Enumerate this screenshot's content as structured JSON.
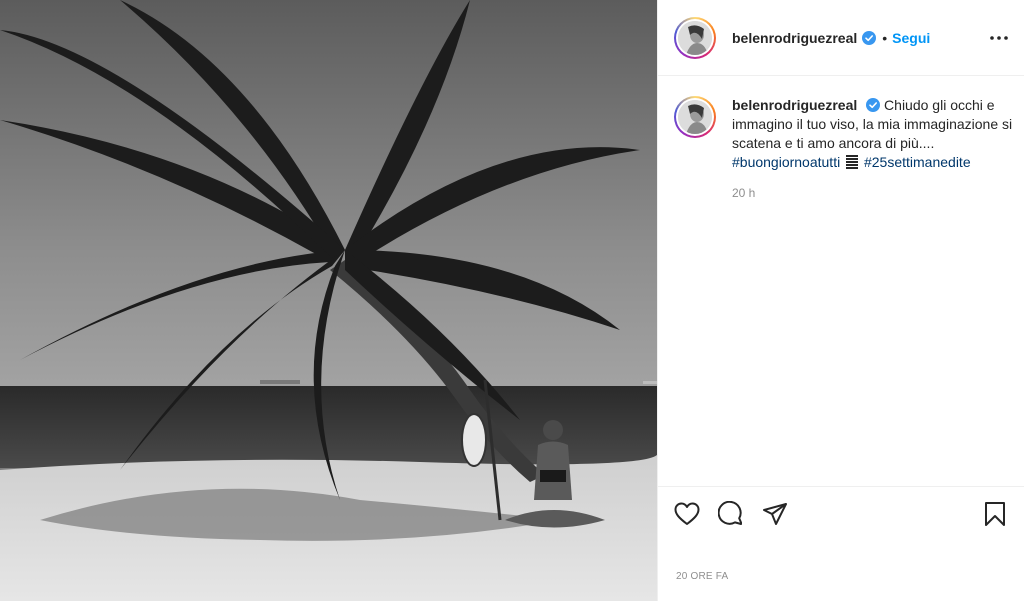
{
  "post": {
    "photo": {
      "alt_icon": "photo-beach-palm-tree"
    },
    "header": {
      "username": "belenrodriguezreal",
      "separator": "•",
      "follow_label": "Segui",
      "verified_icon": "verified-badge-icon",
      "more_icon": "more-options-icon"
    },
    "caption": {
      "username": "belenrodriguezreal",
      "text": "Chiudo gli occhi e immagino il tuo viso, la mia immaginazione si scatena e ti amo ancora di più....",
      "hashtag_1": "#buongiornoatutti",
      "hashtag_2": "#25settimanedite",
      "time": "20 h"
    },
    "actions": {
      "like_icon": "heart-icon",
      "comment_icon": "comment-icon",
      "share_icon": "paper-plane-icon",
      "save_icon": "bookmark-icon"
    },
    "date": "20 ORE FA"
  },
  "colors": {
    "accent": "#0095f6",
    "hashtag": "#00376b",
    "text": "#262626",
    "muted": "#8e8e8e",
    "verified": "#3897f0"
  }
}
